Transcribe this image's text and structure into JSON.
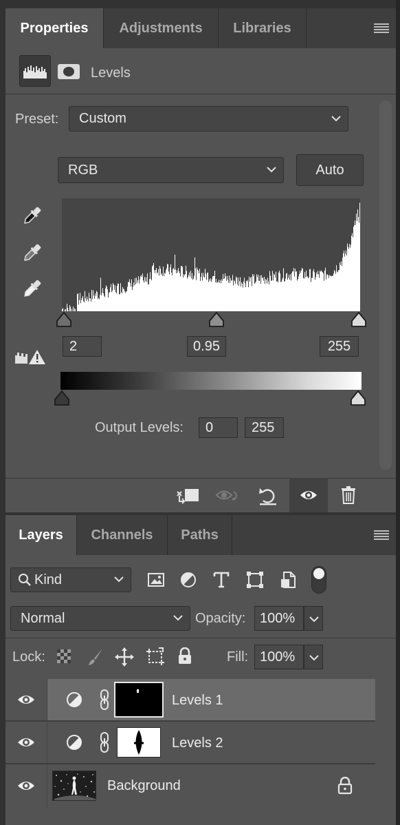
{
  "properties_panel": {
    "tabs": [
      {
        "label": "Properties",
        "active": true
      },
      {
        "label": "Adjustments",
        "active": false
      },
      {
        "label": "Libraries",
        "active": false
      }
    ],
    "title": "Levels",
    "preset_label": "Preset:",
    "preset_value": "Custom",
    "channel_value": "RGB",
    "auto_label": "Auto",
    "input_black": "2",
    "input_gamma": "0.95",
    "input_white": "255",
    "output_label": "Output Levels:",
    "output_black": "0",
    "output_white": "255",
    "footer_icons": [
      "clip-to-layer-icon",
      "view-previous-state-icon",
      "reset-icon",
      "visibility-icon",
      "delete-icon"
    ]
  },
  "layers_panel": {
    "tabs": [
      {
        "label": "Layers",
        "active": true
      },
      {
        "label": "Channels",
        "active": false
      },
      {
        "label": "Paths",
        "active": false
      }
    ],
    "filter_label": "Kind",
    "filter_icons": [
      "pixel-layer-filter-icon",
      "adjustment-layer-filter-icon",
      "type-layer-filter-icon",
      "shape-layer-filter-icon",
      "smart-object-filter-icon"
    ],
    "blend_mode": "Normal",
    "opacity_label": "Opacity:",
    "opacity_value": "100%",
    "lock_label": "Lock:",
    "lock_icons": [
      "lock-transparent-pixels-icon",
      "lock-image-pixels-icon",
      "lock-position-icon",
      "lock-artboard-icon",
      "lock-all-icon"
    ],
    "fill_label": "Fill:",
    "fill_value": "100%",
    "layers": [
      {
        "name": "Levels 1",
        "type": "adjustment",
        "selected": true,
        "visible": true
      },
      {
        "name": "Levels 2",
        "type": "adjustment",
        "selected": false,
        "visible": true
      },
      {
        "name": "Background",
        "type": "image",
        "selected": false,
        "visible": true,
        "locked": true
      }
    ]
  },
  "colors": {
    "panel_bg": "#535353",
    "tab_bar_bg": "#3e3e3e",
    "field_bg": "#454545",
    "selected_layer_bg": "#6b6b6b",
    "text": "#e8e8e8"
  }
}
